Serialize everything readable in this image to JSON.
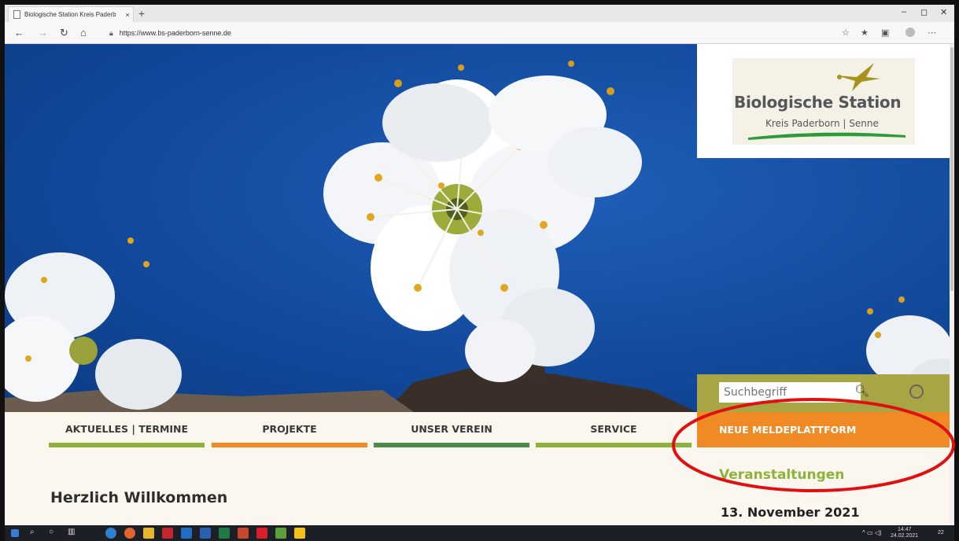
{
  "browser": {
    "tab_title": "Biologische Station Kreis Paderb",
    "tab_close": "×",
    "new_tab": "+",
    "url": "https://www.bs-paderborn-senne.de",
    "window_controls": [
      "–",
      "◻",
      "✕"
    ]
  },
  "logo": {
    "title": "Biologische Station",
    "subtitle": "Kreis Paderborn | Senne"
  },
  "search": {
    "placeholder": "Suchbegriff"
  },
  "buttons": {
    "meldeplattform": "NEUE MELDEPLATTFORM"
  },
  "nav": {
    "items": [
      {
        "label": "AKTUELLES | TERMINE",
        "color": "#8db33a"
      },
      {
        "label": "PROJEKTE",
        "color": "#f08a24"
      },
      {
        "label": "UNSER VEREIN",
        "color": "#4d8b4a"
      },
      {
        "label": "SERVICE",
        "color": "#8db33a"
      }
    ]
  },
  "main": {
    "welcome": "Herzlich Willkommen"
  },
  "sidebar": {
    "events_heading": "Veranstaltungen",
    "first_event_date": "13. November 2021"
  },
  "taskbar": {
    "time": "14:47",
    "date": "24.02.2021",
    "notification_count": "22"
  },
  "colors": {
    "accent_green": "#8db33a",
    "accent_orange": "#f08a24",
    "search_panel": "#a8a545",
    "annotation_red": "#e01010",
    "sky_blue": "#124a9d"
  }
}
